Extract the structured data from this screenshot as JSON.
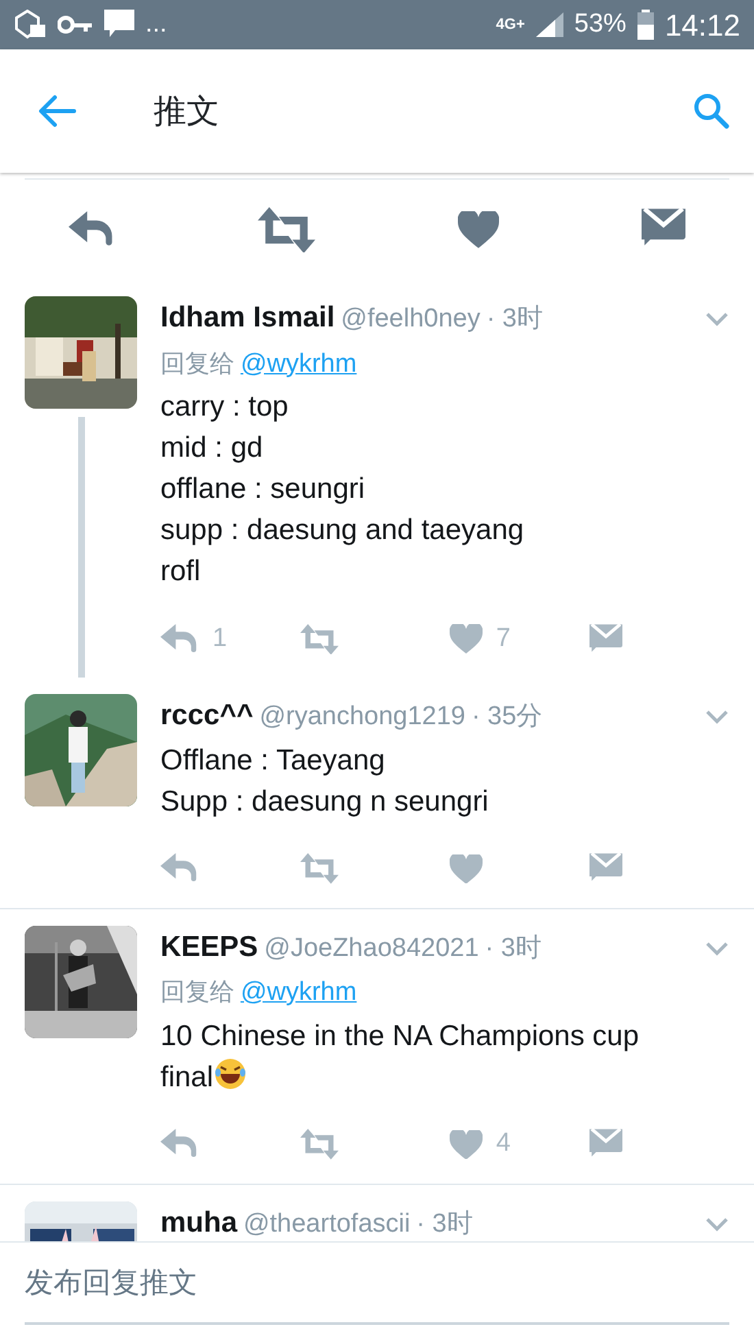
{
  "status_bar": {
    "more": "...",
    "network": "4G+",
    "battery": "53%",
    "time": "14:12"
  },
  "header": {
    "title": "推文"
  },
  "tweets": [
    {
      "name": "Idham Ismail",
      "handle": "@feelh0ney",
      "time": "· 3时",
      "reply_label": "回复给",
      "reply_to": "@wykrhm",
      "text": "carry : top\nmid : gd\nofflane : seungri\nsupp : daesung and taeyang\nrofl",
      "emoji": false,
      "reply_count": "1",
      "like_count": "7",
      "thread": true
    },
    {
      "name": "rccc^^",
      "handle": "@ryanchong1219",
      "time": "· 35分",
      "text": "Offlane : Taeyang\nSupp : daesung n seungri",
      "emoji": false,
      "thread": false
    },
    {
      "name": "KEEPS",
      "handle": "@JoeZhao842021",
      "time": "· 3时",
      "reply_label": "回复给",
      "reply_to": "@wykrhm",
      "text": "10 Chinese in the NA Champions cup final",
      "emoji": true,
      "like_count": "4",
      "thread": false
    },
    {
      "name": "muha",
      "handle": "@theartofascii",
      "time": "· 3时",
      "emoji": false,
      "thread": false,
      "cut": true
    }
  ],
  "compose": {
    "placeholder": "发布回复推文"
  }
}
